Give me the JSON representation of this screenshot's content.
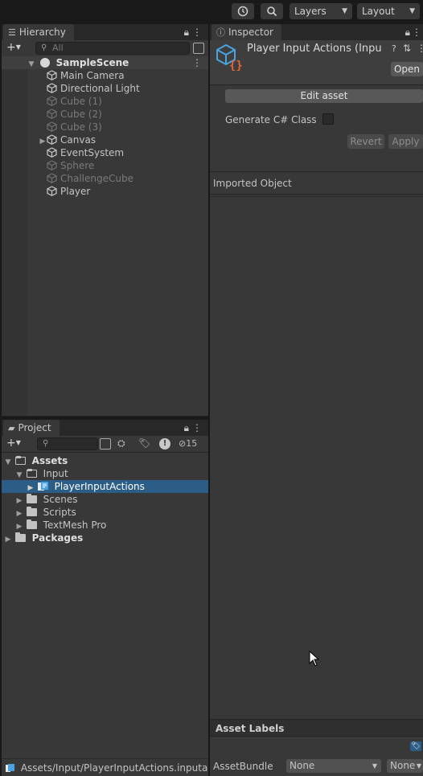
{
  "toolbar": {
    "history_icon": "history-icon",
    "search_icon": "search-icon",
    "layers_label": "Layers",
    "layout_label": "Layout"
  },
  "hierarchy": {
    "tab_label": "Hierarchy",
    "search_placeholder": "All",
    "scene_name": "SampleScene",
    "items": [
      {
        "label": "Main Camera",
        "active": true,
        "expandable": false
      },
      {
        "label": "Directional Light",
        "active": true,
        "expandable": false
      },
      {
        "label": "Cube (1)",
        "active": false,
        "expandable": false
      },
      {
        "label": "Cube (2)",
        "active": false,
        "expandable": false
      },
      {
        "label": "Cube (3)",
        "active": false,
        "expandable": false
      },
      {
        "label": "Canvas",
        "active": true,
        "expandable": true
      },
      {
        "label": "EventSystem",
        "active": true,
        "expandable": false
      },
      {
        "label": "Sphere",
        "active": false,
        "expandable": false
      },
      {
        "label": "ChallengeCube",
        "active": false,
        "expandable": false
      },
      {
        "label": "Player",
        "active": true,
        "expandable": false
      }
    ]
  },
  "project": {
    "tab_label": "Project",
    "hidden_count": "15",
    "tree": {
      "assets": "Assets",
      "input": "Input",
      "player_input_actions": "PlayerInputActions",
      "scenes": "Scenes",
      "scripts": "Scripts",
      "textmesh": "TextMesh Pro",
      "packages": "Packages"
    },
    "status_path": "Assets/Input/PlayerInputActions.inputacti"
  },
  "inspector": {
    "tab_label": "Inspector",
    "asset_title": "Player Input Actions (Input",
    "open_label": "Open",
    "edit_asset_label": "Edit asset",
    "generate_label": "Generate C# Class",
    "revert_label": "Revert",
    "apply_label": "Apply",
    "imported_object_label": "Imported Object",
    "asset_labels_title": "Asset Labels",
    "asset_bundle_label": "AssetBundle",
    "asset_bundle_value": "None",
    "asset_variant_value": "None"
  },
  "colors": {
    "accent_selection": "#2c5d87",
    "panel_bg": "#383838",
    "icon_blue": "#4aa3df",
    "icon_orange": "#e8643b"
  }
}
